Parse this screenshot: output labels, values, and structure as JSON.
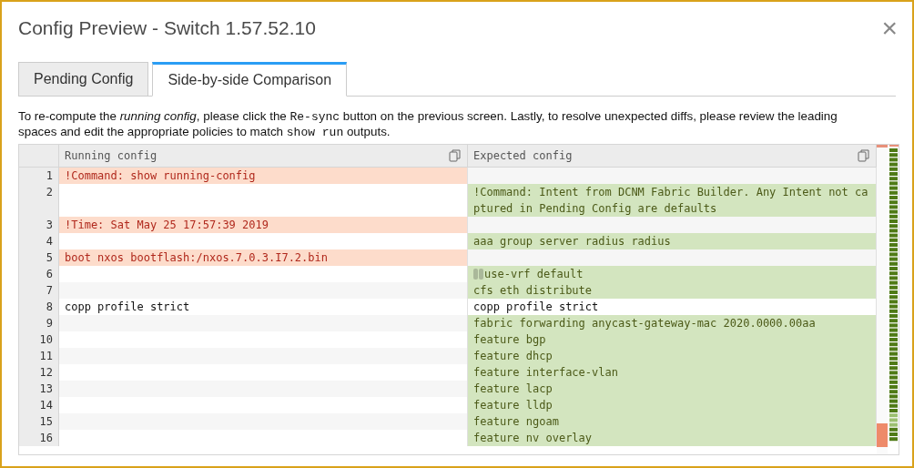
{
  "window": {
    "title": "Config Preview - Switch 1.57.52.10",
    "close": "×"
  },
  "tabs": [
    {
      "label": "Pending Config",
      "selected": false
    },
    {
      "label": "Side-by-side Comparison",
      "selected": true
    }
  ],
  "note": [
    {
      "kind": "plain",
      "text": "To re-compute the "
    },
    {
      "kind": "italic",
      "text": "running config"
    },
    {
      "kind": "plain",
      "text": ", please click the "
    },
    {
      "kind": "code",
      "text": "Re-sync"
    },
    {
      "kind": "plain",
      "text": " button on the previous screen. Lastly, to resolve unexpected diffs, please review the leading spaces and edit the appropriate policies to match "
    },
    {
      "kind": "code",
      "text": "show run"
    },
    {
      "kind": "plain",
      "text": " outputs."
    }
  ],
  "diff": {
    "left_title": "Running config",
    "right_title": "Expected config",
    "rows": [
      {
        "number": "1",
        "left": {
          "kind": "removed",
          "text": "!Command: show running-config"
        },
        "right": {
          "kind": "blank"
        }
      },
      {
        "number": "2",
        "left": {
          "kind": "blank"
        },
        "right": {
          "kind": "added",
          "text": "!Command: Intent from DCNM Fabric Builder. Any Intent not captured in Pending Config are defaults"
        }
      },
      {
        "number": "3",
        "left": {
          "kind": "removed",
          "text": "!Time: Sat May 25 17:57:39 2019"
        },
        "right": {
          "kind": "blank"
        }
      },
      {
        "number": "4",
        "left": {
          "kind": "blank"
        },
        "right": {
          "kind": "added",
          "text": "aaa group server radius radius"
        }
      },
      {
        "number": "5",
        "left": {
          "kind": "removed",
          "text": "boot nxos bootflash:/nxos.7.0.3.I7.2.bin"
        },
        "right": {
          "kind": "blank"
        }
      },
      {
        "number": "6",
        "left": {
          "kind": "blank"
        },
        "right": {
          "kind": "added",
          "text": "use-vrf default",
          "leading_whitespace": true
        }
      },
      {
        "number": "7",
        "left": {
          "kind": "blank"
        },
        "right": {
          "kind": "added",
          "text": "cfs eth distribute"
        }
      },
      {
        "number": "8",
        "left": {
          "kind": "same",
          "text": "copp profile strict"
        },
        "right": {
          "kind": "same",
          "text": "copp profile strict"
        }
      },
      {
        "number": "9",
        "left": {
          "kind": "blank"
        },
        "right": {
          "kind": "added",
          "text": "fabric forwarding anycast-gateway-mac 2020.0000.00aa"
        }
      },
      {
        "number": "10",
        "left": {
          "kind": "blank"
        },
        "right": {
          "kind": "added",
          "text": "feature bgp"
        }
      },
      {
        "number": "11",
        "left": {
          "kind": "blank"
        },
        "right": {
          "kind": "added",
          "text": "feature dhcp"
        }
      },
      {
        "number": "12",
        "left": {
          "kind": "blank"
        },
        "right": {
          "kind": "added",
          "text": "feature interface-vlan"
        }
      },
      {
        "number": "13",
        "left": {
          "kind": "blank"
        },
        "right": {
          "kind": "added",
          "text": "feature lacp"
        }
      },
      {
        "number": "14",
        "left": {
          "kind": "blank"
        },
        "right": {
          "kind": "added",
          "text": "feature lldp"
        }
      },
      {
        "number": "15",
        "left": {
          "kind": "blank"
        },
        "right": {
          "kind": "added",
          "text": "feature ngoam"
        }
      },
      {
        "number": "16",
        "left": {
          "kind": "blank"
        },
        "right": {
          "kind": "added",
          "text": "feature nv overlay"
        }
      }
    ]
  }
}
